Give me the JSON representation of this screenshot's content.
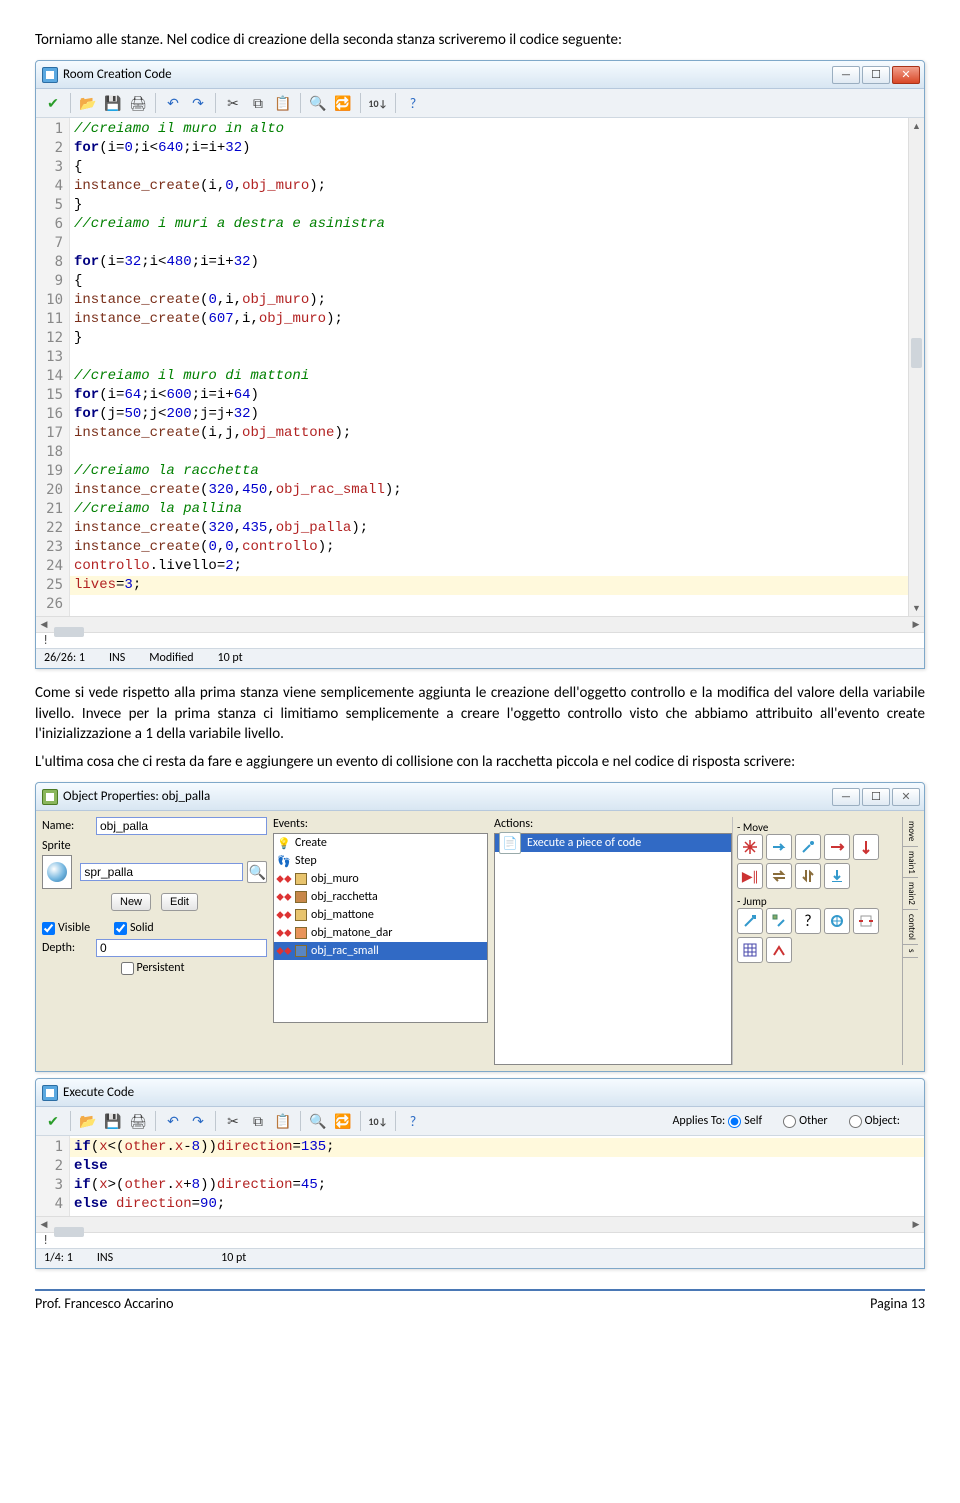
{
  "doc": {
    "p1": "Torniamo alle stanze. Nel codice di creazione della seconda stanza scriveremo il codice seguente:",
    "p2": "Come si vede rispetto alla prima stanza viene semplicemente aggiunta le creazione dell'oggetto controllo e la modifica del valore della variabile livello. Invece per la prima stanza ci limitiamo semplicemente a creare l'oggetto controllo visto che abbiamo attribuito all'evento create l'inizializzazione a 1 della variabile livello.",
    "p3": "L'ultima cosa che ci resta da fare e aggiungere un evento di collisione con la racchetta piccola e nel codice di risposta scrivere:"
  },
  "editor1": {
    "title": "Room Creation Code",
    "status": {
      "pos": "26/26:  1",
      "ins": "INS",
      "mod": "Modified",
      "pt": "10 pt"
    }
  },
  "code1_lines": [
    {
      "n": 1,
      "html": "<span class='cm'>//creiamo il muro in alto</span>"
    },
    {
      "n": 2,
      "html": "<span class='kw'>for</span>(i=<span class='num'>0</span>;i&lt;<span class='num'>640</span>;i=i+<span class='num'>32</span>)"
    },
    {
      "n": 3,
      "html": "{"
    },
    {
      "n": 4,
      "html": "<span class='fn'>instance_create</span>(i,<span class='num'>0</span>,<span class='id'>obj_muro</span>);"
    },
    {
      "n": 5,
      "html": "}"
    },
    {
      "n": 6,
      "html": "<span class='cm'>//creiamo i muri a destra e asinistra</span>"
    },
    {
      "n": 7,
      "html": ""
    },
    {
      "n": 8,
      "html": "<span class='kw'>for</span>(i=<span class='num'>32</span>;i&lt;<span class='num'>480</span>;i=i+<span class='num'>32</span>)"
    },
    {
      "n": 9,
      "html": "{"
    },
    {
      "n": 10,
      "html": "<span class='fn'>instance_create</span>(<span class='num'>0</span>,i,<span class='id'>obj_muro</span>);"
    },
    {
      "n": 11,
      "html": "<span class='fn'>instance_create</span>(<span class='num'>607</span>,i,<span class='id'>obj_muro</span>);"
    },
    {
      "n": 12,
      "html": "}"
    },
    {
      "n": 13,
      "html": ""
    },
    {
      "n": 14,
      "html": "<span class='cm'>//creiamo il muro di mattoni</span>"
    },
    {
      "n": 15,
      "html": "<span class='kw'>for</span>(i=<span class='num'>64</span>;i&lt;<span class='num'>600</span>;i=i+<span class='num'>64</span>)"
    },
    {
      "n": 16,
      "html": "<span class='kw'>for</span>(j=<span class='num'>50</span>;j&lt;<span class='num'>200</span>;j=j+<span class='num'>32</span>)"
    },
    {
      "n": 17,
      "html": "<span class='fn'>instance_create</span>(i,j,<span class='id'>obj_mattone</span>);"
    },
    {
      "n": 18,
      "html": ""
    },
    {
      "n": 19,
      "html": "<span class='cm'>//creiamo la racchetta</span>"
    },
    {
      "n": 20,
      "html": "<span class='fn'>instance_create</span>(<span class='num'>320</span>,<span class='num'>450</span>,<span class='id'>obj_rac_small</span>);"
    },
    {
      "n": 21,
      "html": "<span class='cm'>//creiamo la pallina</span>"
    },
    {
      "n": 22,
      "html": "<span class='fn'>instance_create</span>(<span class='num'>320</span>,<span class='num'>435</span>,<span class='id'>obj_palla</span>);"
    },
    {
      "n": 23,
      "html": "<span class='fn'>instance_create</span>(<span class='num'>0</span>,<span class='num'>0</span>,<span class='id'>controllo</span>);"
    },
    {
      "n": 24,
      "html": "<span class='id'>controllo</span>.livello=<span class='num'>2</span>;"
    },
    {
      "n": 25,
      "html": "<span class='id'>lives</span>=<span class='num'>3</span>;",
      "hl": true
    },
    {
      "n": 26,
      "html": ""
    }
  ],
  "objprops": {
    "title": "Object Properties: obj_palla",
    "name_label": "Name:",
    "name_value": "obj_palla",
    "sprite_label": "Sprite",
    "sprite_value": "spr_palla",
    "new": "New",
    "edit": "Edit",
    "visible": "Visible",
    "solid": "Solid",
    "depth_label": "Depth:",
    "depth_value": "0",
    "persistent": "Persistent",
    "events_label": "Events:",
    "events": [
      {
        "icon": "bulb",
        "label": "Create"
      },
      {
        "icon": "step",
        "label": "Step"
      },
      {
        "icon": "coll",
        "sq": "#e8c46e",
        "label": "obj_muro"
      },
      {
        "icon": "coll",
        "sq": "#c8884a",
        "label": "obj_racchetta"
      },
      {
        "icon": "coll",
        "sq": "#e8c46e",
        "label": "obj_mattone"
      },
      {
        "icon": "coll",
        "sq": "#e8945a",
        "label": "obj_matone_dar"
      },
      {
        "icon": "coll",
        "sq": "#5a86c2",
        "label": "obj_rac_small",
        "selected": true
      }
    ],
    "actions_label": "Actions:",
    "action_item": "Execute a piece of code",
    "groups": {
      "move": "- Move",
      "jump": "- Jump"
    },
    "vtabs": [
      "move",
      "main1",
      "main2",
      "control",
      "s"
    ]
  },
  "editor2": {
    "title": "Execute Code",
    "applies": "Applies To:",
    "self": "Self",
    "other": "Other",
    "object": "Object:",
    "status": {
      "pos": "1/4:  1",
      "ins": "INS",
      "pt": "10 pt"
    }
  },
  "code2_lines": [
    {
      "n": 1,
      "html": "<span class='kw'>if</span>(<span class='id'>x</span>&lt;(<span class='id'>other</span>.<span class='id'>x</span>-<span class='num'>8</span>))<span class='id'>direction</span>=<span class='num'>135</span>;",
      "hl": true
    },
    {
      "n": 2,
      "html": "<span class='kw'>else</span>"
    },
    {
      "n": 3,
      "html": "<span class='kw'>if</span>(<span class='id'>x</span>&gt;(<span class='id'>other</span>.<span class='id'>x</span>+<span class='num'>8</span>))<span class='id'>direction</span>=<span class='num'>45</span>;"
    },
    {
      "n": 4,
      "html": "<span class='kw'>else</span> <span class='id'>direction</span>=<span class='num'>90</span>;"
    }
  ],
  "footer": {
    "author": "Prof. Francesco Accarino",
    "page": "Pagina 13"
  }
}
